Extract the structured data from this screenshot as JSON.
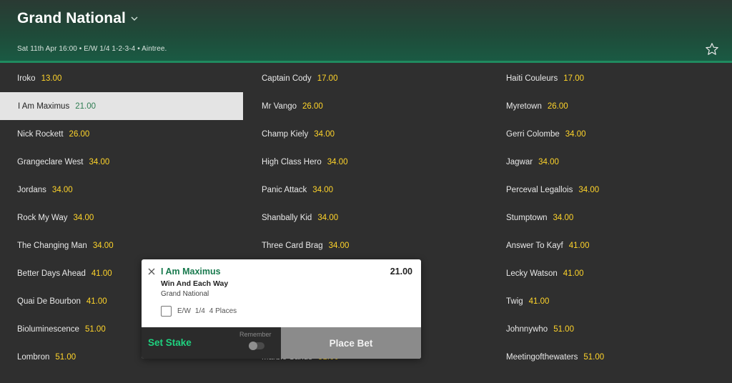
{
  "header": {
    "title": "Grand National",
    "meta": "Sat 11th Apr 16:00  •  E/W 1/4 1-2-3-4  •  Aintree.",
    "icons": {
      "dropdown": "chevron-down-icon",
      "favourite": "star-icon"
    }
  },
  "runners": [
    {
      "name": "Iroko",
      "odds": "13.00",
      "selected": false
    },
    {
      "name": "Captain Cody",
      "odds": "17.00",
      "selected": false
    },
    {
      "name": "Haiti Couleurs",
      "odds": "17.00",
      "selected": false
    },
    {
      "name": "I Am Maximus",
      "odds": "21.00",
      "selected": true
    },
    {
      "name": "Mr Vango",
      "odds": "26.00",
      "selected": false
    },
    {
      "name": "Myretown",
      "odds": "26.00",
      "selected": false
    },
    {
      "name": "Nick Rockett",
      "odds": "26.00",
      "selected": false
    },
    {
      "name": "Champ Kiely",
      "odds": "34.00",
      "selected": false
    },
    {
      "name": "Gerri Colombe",
      "odds": "34.00",
      "selected": false
    },
    {
      "name": "Grangeclare West",
      "odds": "34.00",
      "selected": false
    },
    {
      "name": "High Class Hero",
      "odds": "34.00",
      "selected": false
    },
    {
      "name": "Jagwar",
      "odds": "34.00",
      "selected": false
    },
    {
      "name": "Jordans",
      "odds": "34.00",
      "selected": false
    },
    {
      "name": "Panic Attack",
      "odds": "34.00",
      "selected": false
    },
    {
      "name": "Perceval Legallois",
      "odds": "34.00",
      "selected": false
    },
    {
      "name": "Rock My Way",
      "odds": "34.00",
      "selected": false
    },
    {
      "name": "Shanbally Kid",
      "odds": "34.00",
      "selected": false
    },
    {
      "name": "Stumptown",
      "odds": "34.00",
      "selected": false
    },
    {
      "name": "The Changing Man",
      "odds": "34.00",
      "selected": false
    },
    {
      "name": "Three Card Brag",
      "odds": "34.00",
      "selected": false
    },
    {
      "name": "Answer To Kayf",
      "odds": "41.00",
      "selected": false
    },
    {
      "name": "Better Days Ahead",
      "odds": "41.00",
      "selected": false
    },
    null,
    {
      "name": "Lecky Watson",
      "odds": "41.00",
      "selected": false
    },
    {
      "name": "Quai De Bourbon",
      "odds": "41.00",
      "selected": false
    },
    null,
    {
      "name": "Twig",
      "odds": "41.00",
      "selected": false
    },
    {
      "name": "Bioluminescence",
      "odds": "51.00",
      "selected": false
    },
    null,
    {
      "name": "Johnnywho",
      "odds": "51.00",
      "selected": false
    },
    {
      "name": "Lombron",
      "odds": "51.00",
      "selected": false
    },
    {
      "name": "Marble Sands",
      "odds": "51.00",
      "selected": false
    },
    {
      "name": "Meetingofthewaters",
      "odds": "51.00",
      "selected": false
    }
  ],
  "betslip": {
    "selection": "I Am Maximus",
    "odds": "21.00",
    "market": "Win And Each Way",
    "event": "Grand National",
    "ew_label": "E/W",
    "ew_fraction": "1/4",
    "ew_places": "4 Places",
    "stake_label": "Set Stake",
    "remember_label": "Remember",
    "place_bet_label": "Place Bet",
    "icons": {
      "close": "close-icon"
    },
    "colors": {
      "selection": "#197a4e",
      "stake": "#1fd17f",
      "odds": "#ffd42a"
    }
  }
}
